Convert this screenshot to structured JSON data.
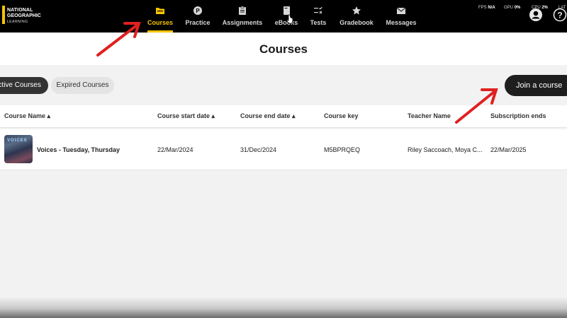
{
  "brand": {
    "line1": "NATIONAL",
    "line2": "GEOGRAPHIC",
    "line3": "LEARNING",
    "accent": "#f5c400"
  },
  "nav": {
    "items": [
      {
        "label": "Courses",
        "icon": "folder-icon",
        "active": true
      },
      {
        "label": "Practice",
        "icon": "practice-icon",
        "active": false
      },
      {
        "label": "Assignments",
        "icon": "clipboard-icon",
        "active": false
      },
      {
        "label": "eBooks",
        "icon": "book-icon",
        "active": false
      },
      {
        "label": "Tests",
        "icon": "checklist-icon",
        "active": false
      },
      {
        "label": "Gradebook",
        "icon": "star-icon",
        "active": false
      },
      {
        "label": "Messages",
        "icon": "envelope-icon",
        "active": false
      }
    ]
  },
  "stats": {
    "fps_label": "FPS",
    "fps_value": "N/A",
    "gpu_label": "GPU",
    "gpu_value": "0%",
    "cpu_label": "CPU",
    "cpu_value": "2%",
    "lat_label": "LAT"
  },
  "page": {
    "title": "Courses"
  },
  "filters": {
    "active": "Active Courses",
    "expired": "Expired Courses"
  },
  "join_label": "Join a course",
  "table": {
    "headers": [
      "Course Name",
      "Course start date",
      "Course end date",
      "Course key",
      "Teacher Name",
      "Subscription ends"
    ],
    "rows": [
      {
        "name": "Voices - Tuesday, Thursday",
        "start": "22/Mar/2024",
        "end": "31/Dec/2024",
        "key": "M5BPRQEQ",
        "teacher": "Riley Saccoach, Moya C...",
        "subscription": "22/Mar/2025",
        "thumb_text": "VOICES"
      }
    ]
  },
  "colors": {
    "nav_bg": "#000000",
    "accent": "#f5c400",
    "annotation_arrow": "#e02020"
  }
}
